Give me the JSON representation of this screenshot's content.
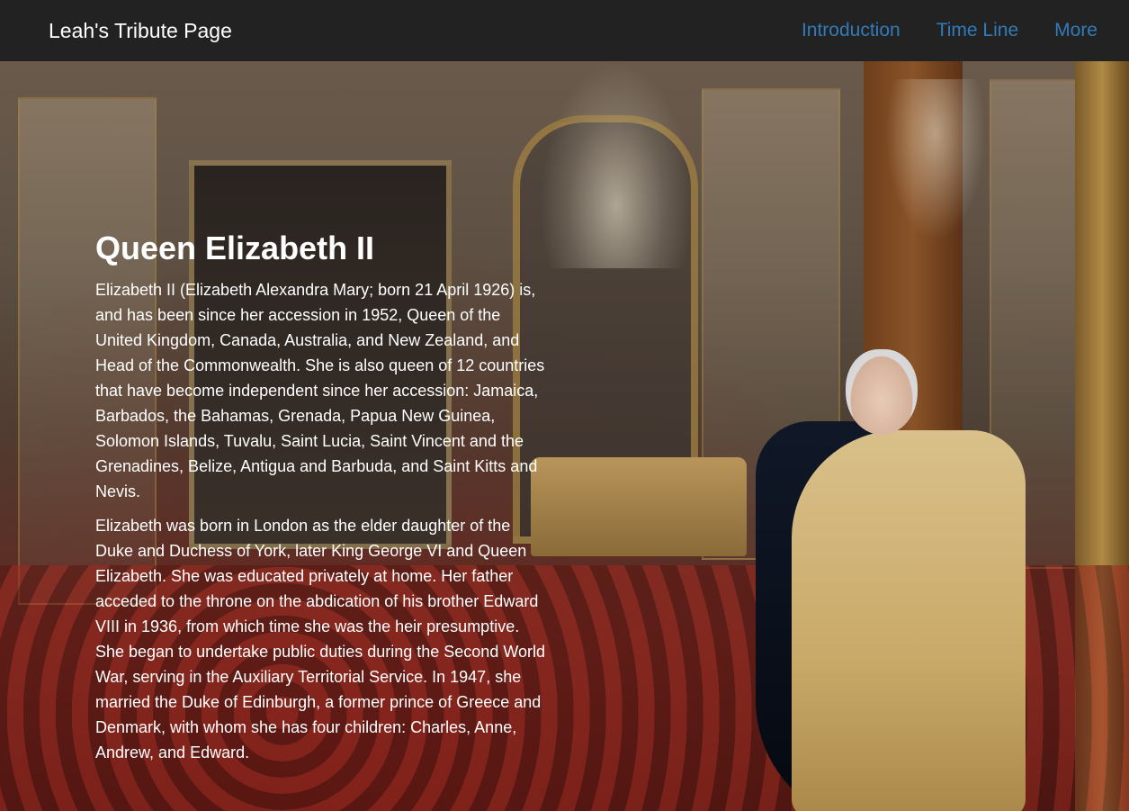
{
  "navbar": {
    "brand": "Leah's Tribute Page",
    "links": [
      {
        "label": "Introduction"
      },
      {
        "label": "Time Line"
      },
      {
        "label": "More"
      }
    ]
  },
  "main": {
    "title": "Queen Elizabeth II",
    "paragraphs": [
      "Elizabeth II (Elizabeth Alexandra Mary; born 21 April 1926) is, and has been since her accession in 1952, Queen of the United Kingdom, Canada, Australia, and New Zealand, and Head of the Commonwealth. She is also queen of 12 countries that have become independent since her accession: Jamaica, Barbados, the Bahamas, Grenada, Papua New Guinea, Solomon Islands, Tuvalu, Saint Lucia, Saint Vincent and the Grenadines, Belize, Antigua and Barbuda, and Saint Kitts and Nevis.",
      "Elizabeth was born in London as the elder daughter of the Duke and Duchess of York, later King George VI and Queen Elizabeth. She was educated privately at home. Her father acceded to the throne on the abdication of his brother Edward VIII in 1936, from which time she was the heir presumptive. She began to undertake public duties during the Second World War, serving in the Auxiliary Territorial Service. In 1947, she married the Duke of Edinburgh, a former prince of Greece and Denmark, with whom she has four children: Charles, Anne, Andrew, and Edward."
    ]
  },
  "colors": {
    "navbar_bg": "#222222",
    "brand_text": "#ffffff",
    "link": "#337ab7",
    "body_text": "#ffffff"
  }
}
